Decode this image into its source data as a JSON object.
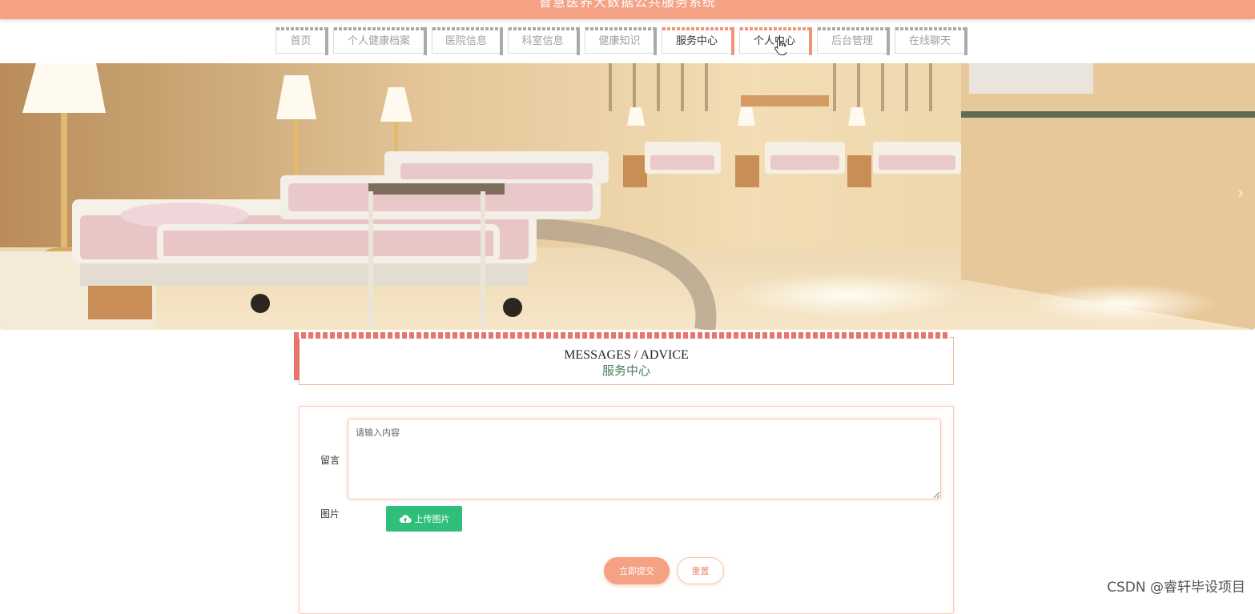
{
  "app": {
    "title": "智慧医养大数据公共服务系统"
  },
  "nav": {
    "items": [
      {
        "label": "首页"
      },
      {
        "label": "个人健康档案"
      },
      {
        "label": "医院信息"
      },
      {
        "label": "科室信息"
      },
      {
        "label": "健康知识"
      },
      {
        "label": "服务中心",
        "active": true
      },
      {
        "label": "个人中心",
        "active": true
      },
      {
        "label": "后台管理"
      },
      {
        "label": "在线聊天"
      }
    ]
  },
  "banner": {
    "next_icon": "chevron-right-icon",
    "next_glyph": "›"
  },
  "section": {
    "title_en": "MESSAGES / ADVICE",
    "title_cn": "服务中心"
  },
  "form": {
    "message_label": "留言",
    "message_placeholder": "请输入内容",
    "message_value": "",
    "image_label": "图片",
    "upload_label": "上传图片",
    "submit_label": "立即提交",
    "reset_label": "重置"
  },
  "watermark": "CSDN @睿轩毕设项目",
  "colors": {
    "accent": "#f4a184",
    "stripe": "#e8756a",
    "upload": "#2fbf7a"
  }
}
